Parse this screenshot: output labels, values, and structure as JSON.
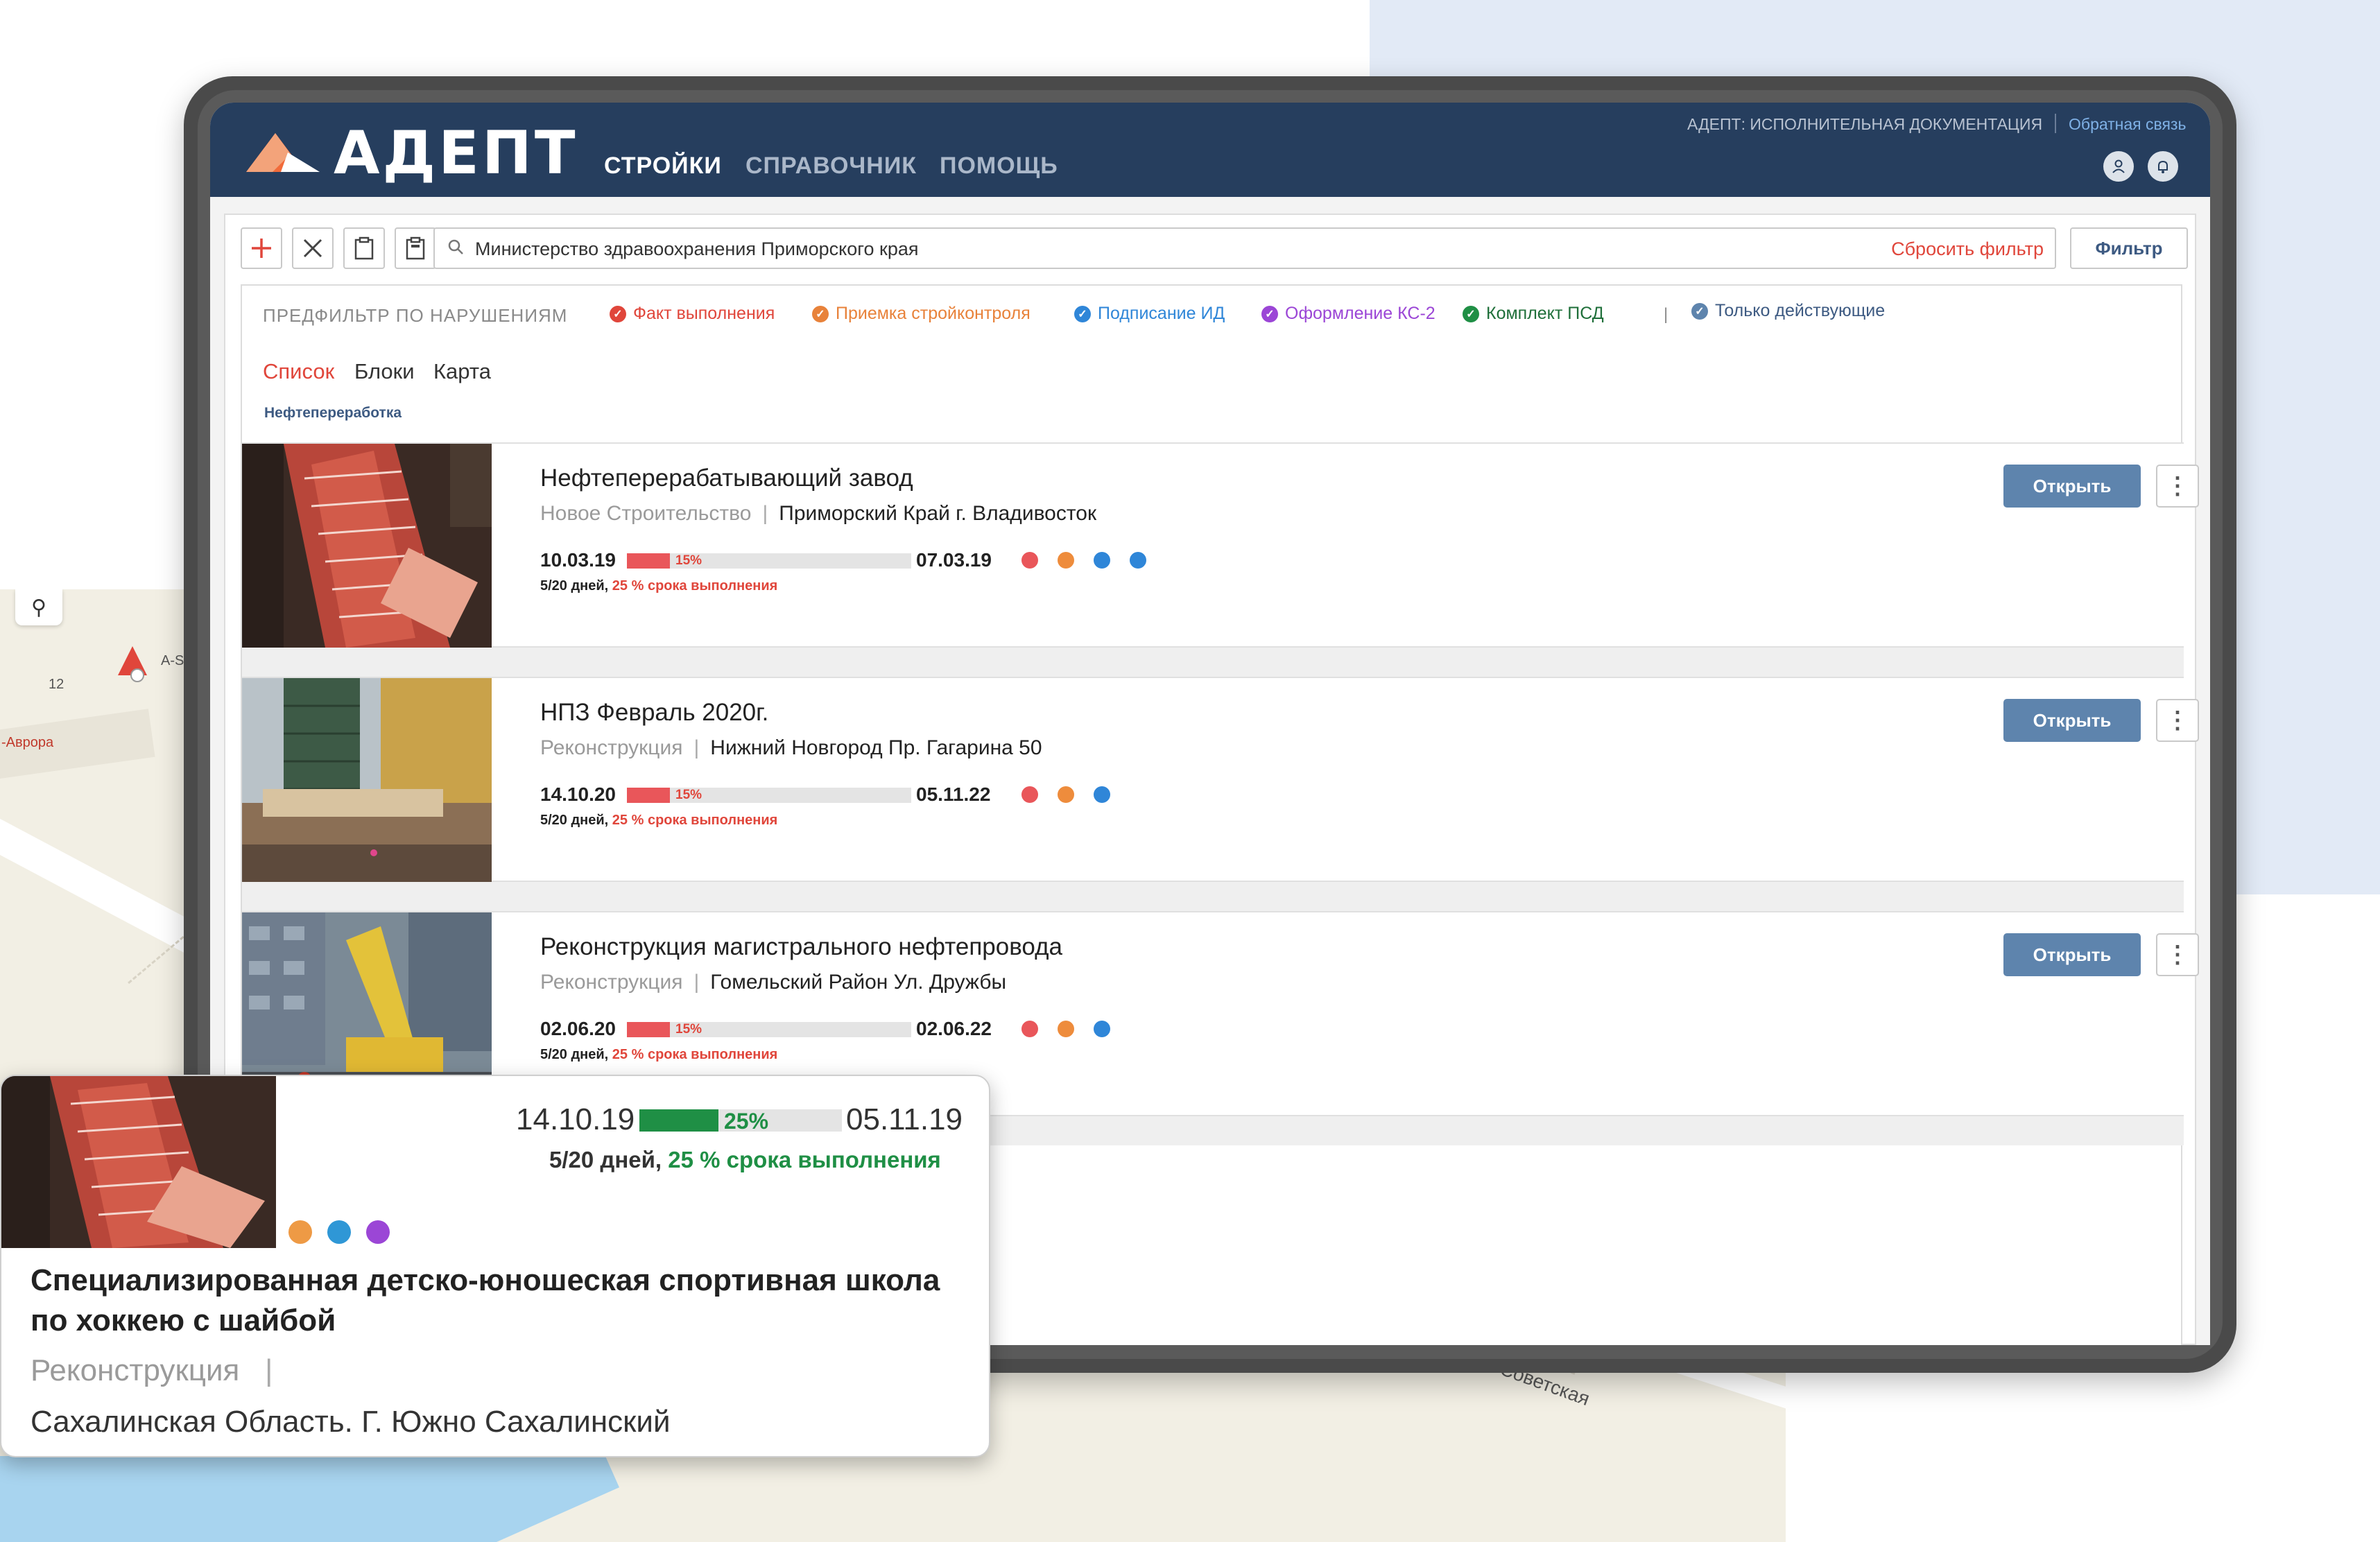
{
  "header": {
    "logo_text": "АДЕПТ",
    "nav": [
      "СТРОЙКИ",
      "СПРАВОЧНИК",
      "ПОМОЩЬ"
    ],
    "subtitle": "АДЕПТ: ИСПОЛНИТЕЛЬНАЯ ДОКУМЕНТАЦИЯ",
    "feedback": "Обратная связь",
    "icons": [
      "user-icon",
      "bell-icon"
    ]
  },
  "toolbar": {
    "buttons": [
      "add-icon",
      "close-icon",
      "clipboard-icon",
      "clipboard-check-icon"
    ],
    "search_value": "Министерство здравоохранения Приморского края",
    "reset_filter": "Сбросить фильтр",
    "filter_button": "Фильтр"
  },
  "prefilter": {
    "label": "ПРЕДФИЛЬТР ПО НАРУШЕНИЯМ",
    "chips": [
      {
        "label": "Факт выполнения",
        "color": "#e0463b"
      },
      {
        "label": "Приемка стройконтроля",
        "color": "#e8823a"
      },
      {
        "label": "Подписание ИД",
        "color": "#2f86d8"
      },
      {
        "label": "Оформление КС-2",
        "color": "#9b46d6"
      },
      {
        "label": "Комплект ПСД",
        "color": "#1f8f45"
      },
      {
        "label": "Только действующие",
        "color": "#5e84ad"
      }
    ],
    "separator": "|"
  },
  "views": {
    "tabs": [
      "Список",
      "Блоки",
      "Карта"
    ],
    "active": "Список"
  },
  "category": "Нефтепереработка",
  "projects": [
    {
      "title": "Нефтеперерабатывающий завод",
      "type": "Новое Строительство",
      "address": "Приморский Край г. Владивосток",
      "start": "10.03.19",
      "end": "07.03.19",
      "progress_label": "15%",
      "days": "5/20 дней,",
      "term": "25 % срока выполнения",
      "dots": [
        "#e9565a",
        "#ee8c3c",
        "#2f86d8",
        "#2f86d8"
      ],
      "open": "Открыть"
    },
    {
      "title": "НПЗ Февраль 2020г.",
      "type": "Реконструкция",
      "address": "Нижний Новгород Пр. Гагарина 50",
      "start": "14.10.20",
      "end": "05.11.22",
      "progress_label": "15%",
      "days": "5/20 дней,",
      "term": "25 % срока выполнения",
      "dots": [
        "#e9565a",
        "#ee8c3c",
        "#2f86d8"
      ],
      "open": "Открыть"
    },
    {
      "title": "Реконструкция магистрального нефтепровода",
      "type": "Реконструкция",
      "address": "Гомельский Район Ул. Дружбы",
      "start": "02.06.20",
      "end": "02.06.22",
      "progress_label": "15%",
      "days": "5/20 дней,",
      "term": "25 % срока выполнения",
      "dots": [
        "#e9565a",
        "#ee8c3c",
        "#2f86d8"
      ],
      "open": "Открыть"
    }
  ],
  "popup": {
    "start": "14.10.19",
    "end": "05.11.19",
    "progress_label": "25%",
    "days": "5/20 дней,",
    "term": "25 % срока выполнения",
    "dots": [
      "#ee9a45",
      "#2f97d6",
      "#9b46d6"
    ],
    "title": "Специализированная детско-юношеская спортивная школа по хоккею с шайбой",
    "type": "Реконструкция",
    "pipe": "|",
    "address": "Сахалинская Область. Г. Южно Сахалинский"
  },
  "map": {
    "labels": [
      "12",
      "-Аврора",
      "A-S",
      "Советская"
    ]
  }
}
